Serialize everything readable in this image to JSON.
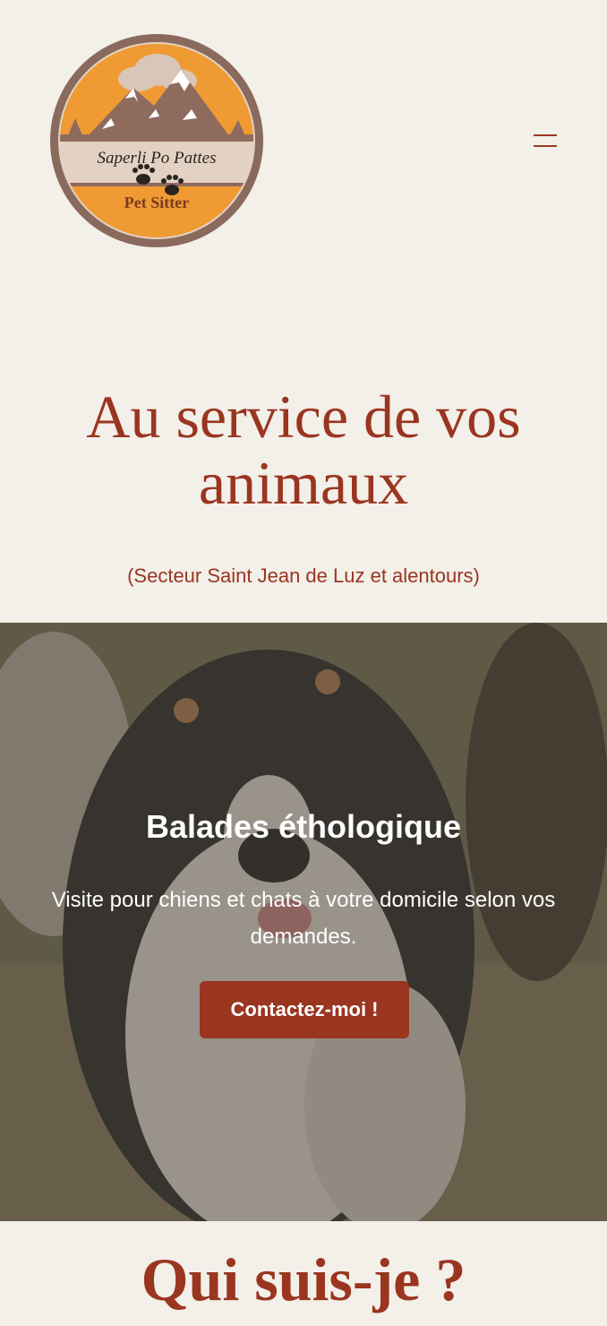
{
  "colors": {
    "background": "#f3efe9",
    "accent": "#9a3520",
    "button": "#9a3520"
  },
  "header": {
    "logo": {
      "line1": "Saperli Po Pattes",
      "line2": "Pet Sitter",
      "icon": "mountain-paw-logo"
    },
    "menu_icon": "hamburger-menu-icon"
  },
  "hero": {
    "title": "Au service de vos animaux",
    "subtitle": "(Secteur Saint Jean de Luz et alentours)"
  },
  "banner": {
    "title": "Balades éthologique",
    "text": "Visite pour chiens et chats à votre domicile selon vos demandes.",
    "button_label": "Contactez-moi !"
  },
  "about": {
    "title": "Qui suis-je ?"
  }
}
